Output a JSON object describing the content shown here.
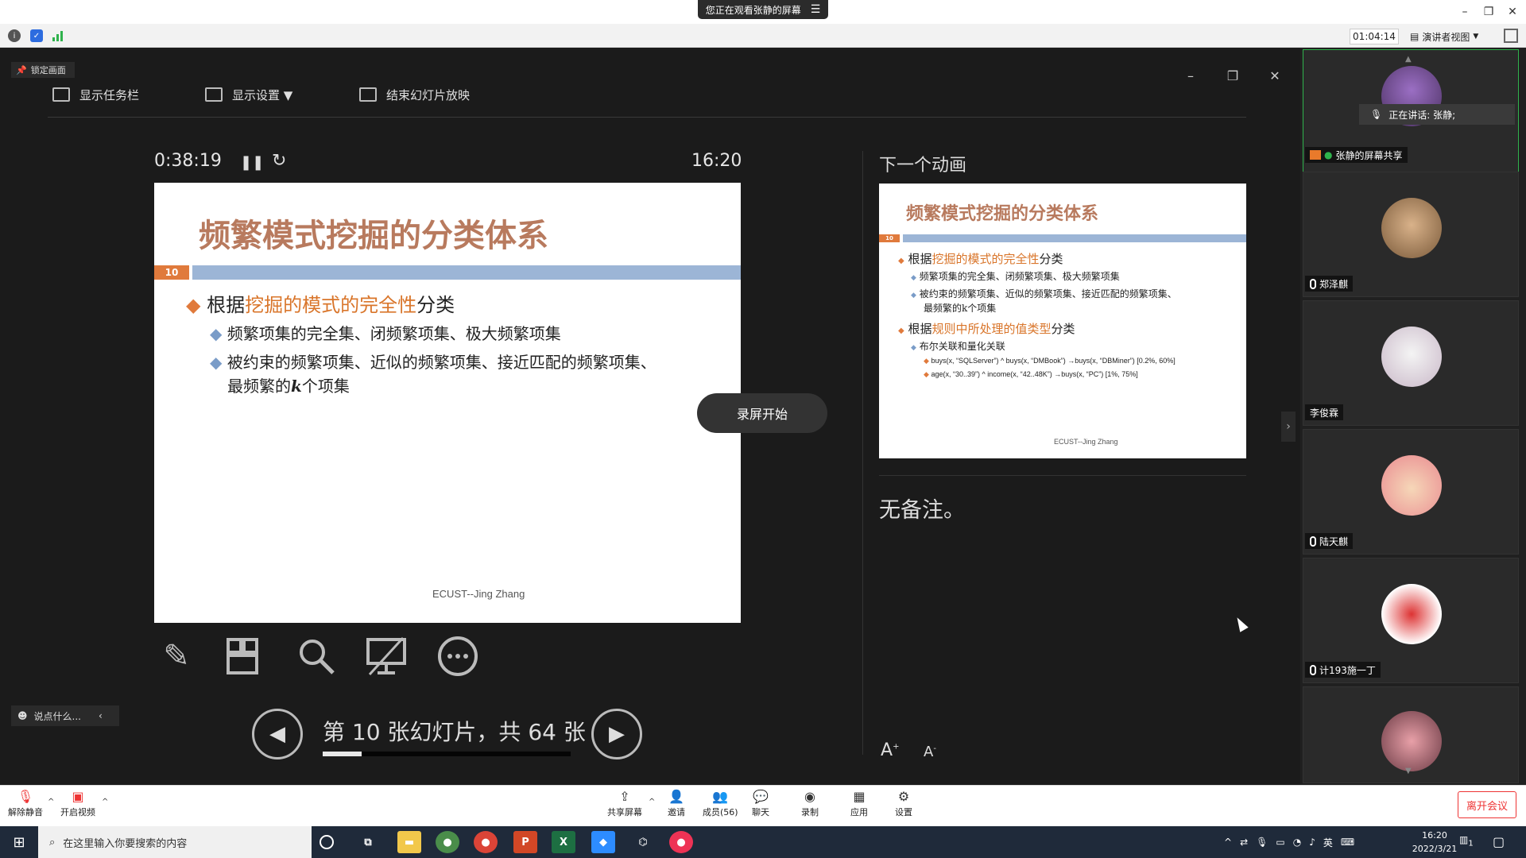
{
  "banner": {
    "text": "您正在观看张静的屏幕",
    "icon": "menu-icon"
  },
  "window_controls": {
    "minimize": "–",
    "restore": "❐",
    "close": "✕"
  },
  "info_bar": {
    "meeting_time": "01:04:14",
    "view_label": "演讲者视图"
  },
  "presenter": {
    "lock_label": "锁定画面",
    "show_taskbar": "显示任务栏",
    "display_settings": "显示设置 ▼",
    "end_slideshow": "结束幻灯片放映",
    "elapsed": "0:38:19",
    "clock": "16:20",
    "next_label": "下一个动画",
    "notes": "无备注。",
    "slide_counter": "第 10 张幻灯片，共 64 张",
    "progress_fraction": 0.156,
    "record_badge": "录屏开始",
    "chat_placeholder": "说点什么...",
    "font_up": "A",
    "font_down": "A"
  },
  "slide": {
    "title": "频繁模式挖掘的分类体系",
    "number": "10",
    "bullet1_prefix": "根据",
    "bullet1_highlight": "挖掘的模式的完全性",
    "bullet1_suffix": "分类",
    "sub1": "频繁项集的完全集、闭频繁项集、极大频繁项集",
    "sub2": "被约束的频繁项集、近似的频繁项集、接近匹配的频繁项集、",
    "sub2b_pre": "最频繁的",
    "sub2b_k": "k",
    "sub2b_post": "个项集",
    "footer": "ECUST--Jing Zhang"
  },
  "next_slide": {
    "title": "频繁模式挖掘的分类体系",
    "number": "10",
    "b1_prefix": "根据",
    "b1_highlight": "挖掘的模式的完全性",
    "b1_suffix": "分类",
    "s1": "频繁项集的完全集、闭频繁项集、极大频繁项集",
    "s2": "被约束的频繁项集、近似的频繁项集、接近匹配的频繁项集、",
    "s2b": "最频繁的k个项集",
    "b2_prefix": "根据",
    "b2_highlight": "规则中所处理的值类型",
    "b2_suffix": "分类",
    "s3": "布尔关联和量化关联",
    "r1": "buys(x, “SQLServer”) ^ buys(x, “DMBook”) →buys(x, “DBMiner”) [0.2%, 60%]",
    "r2": "age(x, “30..39”) ^ income(x, “42..48K”) →buys(x, “PC”) [1%, 75%]",
    "footer": "ECUST--Jing Zhang"
  },
  "participants": {
    "speaking_label": "正在讲话: 张静;",
    "share_label": "张静的屏幕共享",
    "names": [
      "郑泽麒",
      "李俊霖",
      "陆天麒",
      "计193施一丁"
    ]
  },
  "toolbar": {
    "unmute": "解除静音",
    "start_video": "开启视频",
    "share": "共享屏幕",
    "invite": "邀请",
    "members": "成员(56)",
    "chat": "聊天",
    "record": "录制",
    "apps": "应用",
    "settings": "设置",
    "leave": "离开会议"
  },
  "taskbar": {
    "search_placeholder": "在这里输入你要搜索的内容",
    "ime": "英",
    "time": "16:20",
    "date": "2022/3/21",
    "notification_count": "1"
  }
}
